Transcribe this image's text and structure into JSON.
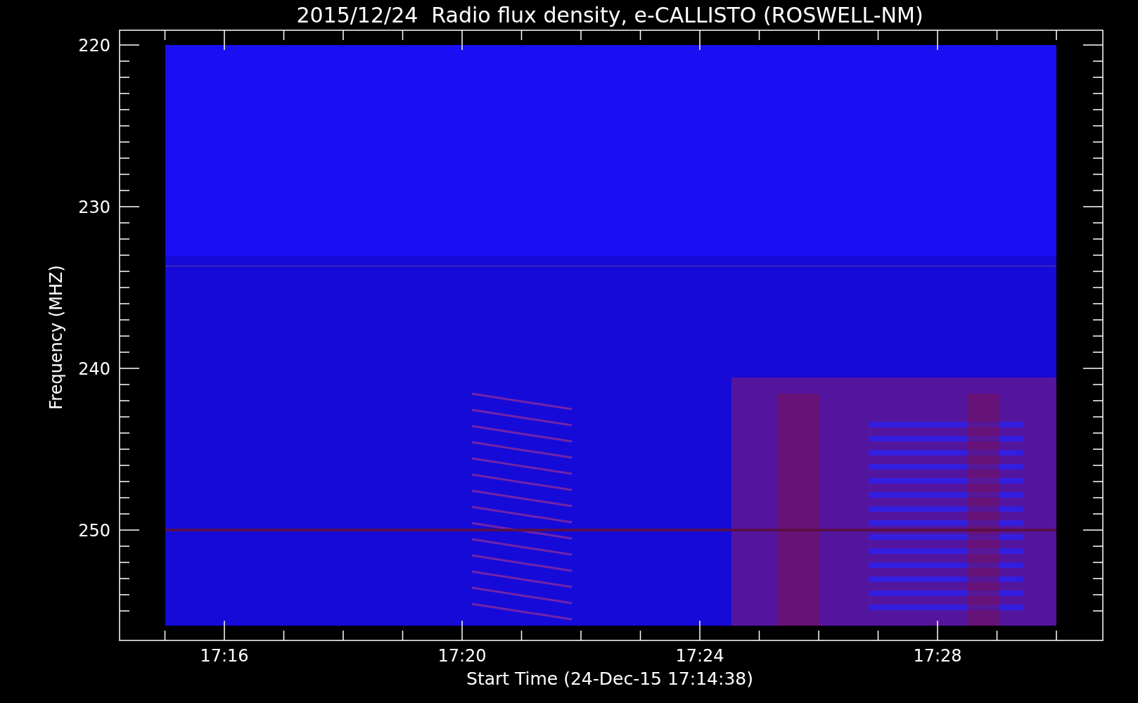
{
  "title": "2015/12/24  Radio flux density, e-CALLISTO (ROSWELL-NM)",
  "y_axis": {
    "label": "Frequency (MHZ)",
    "ticks": [
      "220",
      "230",
      "240",
      "250"
    ]
  },
  "x_axis": {
    "label": "Start Time (24-Dec-15 17:14:38)",
    "ticks": [
      "17:16",
      "17:20",
      "17:24",
      "17:28"
    ]
  }
}
